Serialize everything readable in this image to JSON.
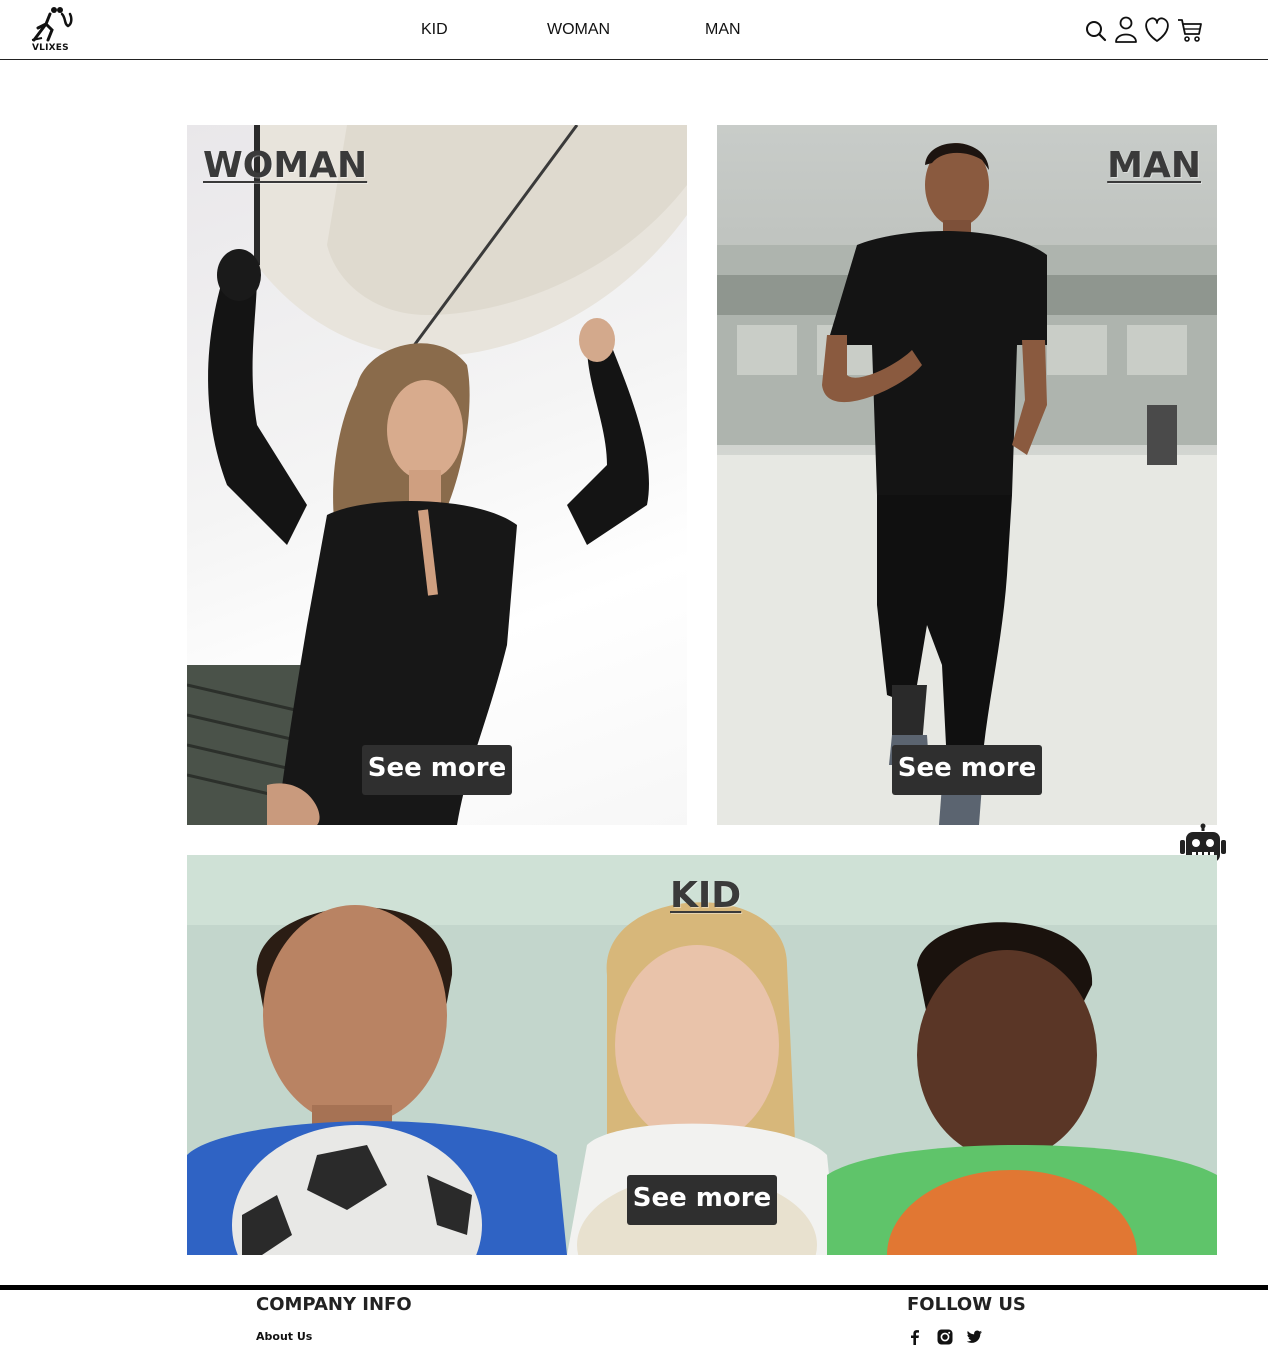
{
  "header": {
    "brand": "VLIXES",
    "nav": [
      {
        "label": "KID"
      },
      {
        "label": "WOMAN"
      },
      {
        "label": "MAN"
      }
    ],
    "icons": [
      "search-icon",
      "user-icon",
      "heart-icon",
      "cart-icon"
    ]
  },
  "categories": {
    "woman": {
      "title": "WOMAN",
      "cta": "See more"
    },
    "man": {
      "title": "MAN",
      "cta": "See more"
    },
    "kid": {
      "title": "KID",
      "cta": "See more"
    }
  },
  "chatbot": {
    "icon": "robot-icon"
  },
  "footer": {
    "company_heading": "COMPANY INFO",
    "about_link": "About Us",
    "follow_heading": "FOLLOW US",
    "social_icons": [
      "facebook-icon",
      "instagram-icon",
      "twitter-icon"
    ]
  },
  "colors": {
    "button_bg": "#2f2f2f",
    "button_text": "#ffffff",
    "title_text": "#3a3a3a",
    "footer_rule": "#000000"
  }
}
